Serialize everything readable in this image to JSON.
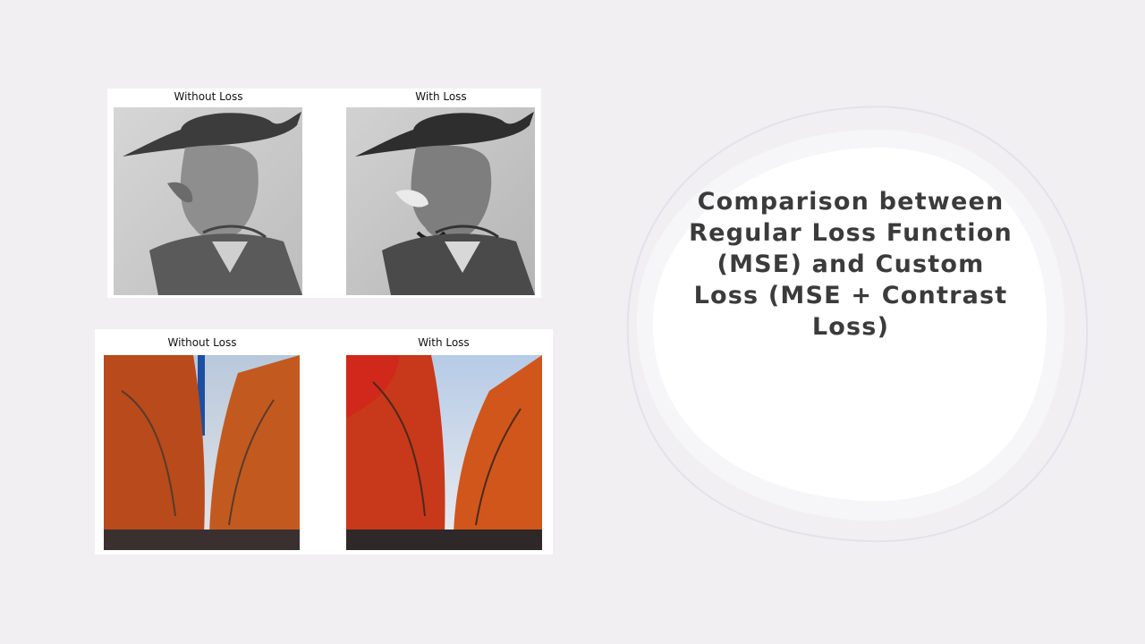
{
  "slide": {
    "title": "Comparison between Regular Loss Function (MSE) and Custom Loss (MSE + Contrast Loss)"
  },
  "panels": [
    {
      "left_caption": "Without Loss",
      "right_caption": "With Loss",
      "subject": "sketch-portrait-man-with-hat"
    },
    {
      "left_caption": "Without Loss",
      "right_caption": "With Loss",
      "subject": "autumn-tree-lined-street"
    }
  ],
  "colors": {
    "background": "#f1eff2",
    "blob_fill": "#ffffff",
    "blob_outline": "#e6e4e8",
    "title_text": "#3b3b3b",
    "foliage": "#c2461a"
  }
}
